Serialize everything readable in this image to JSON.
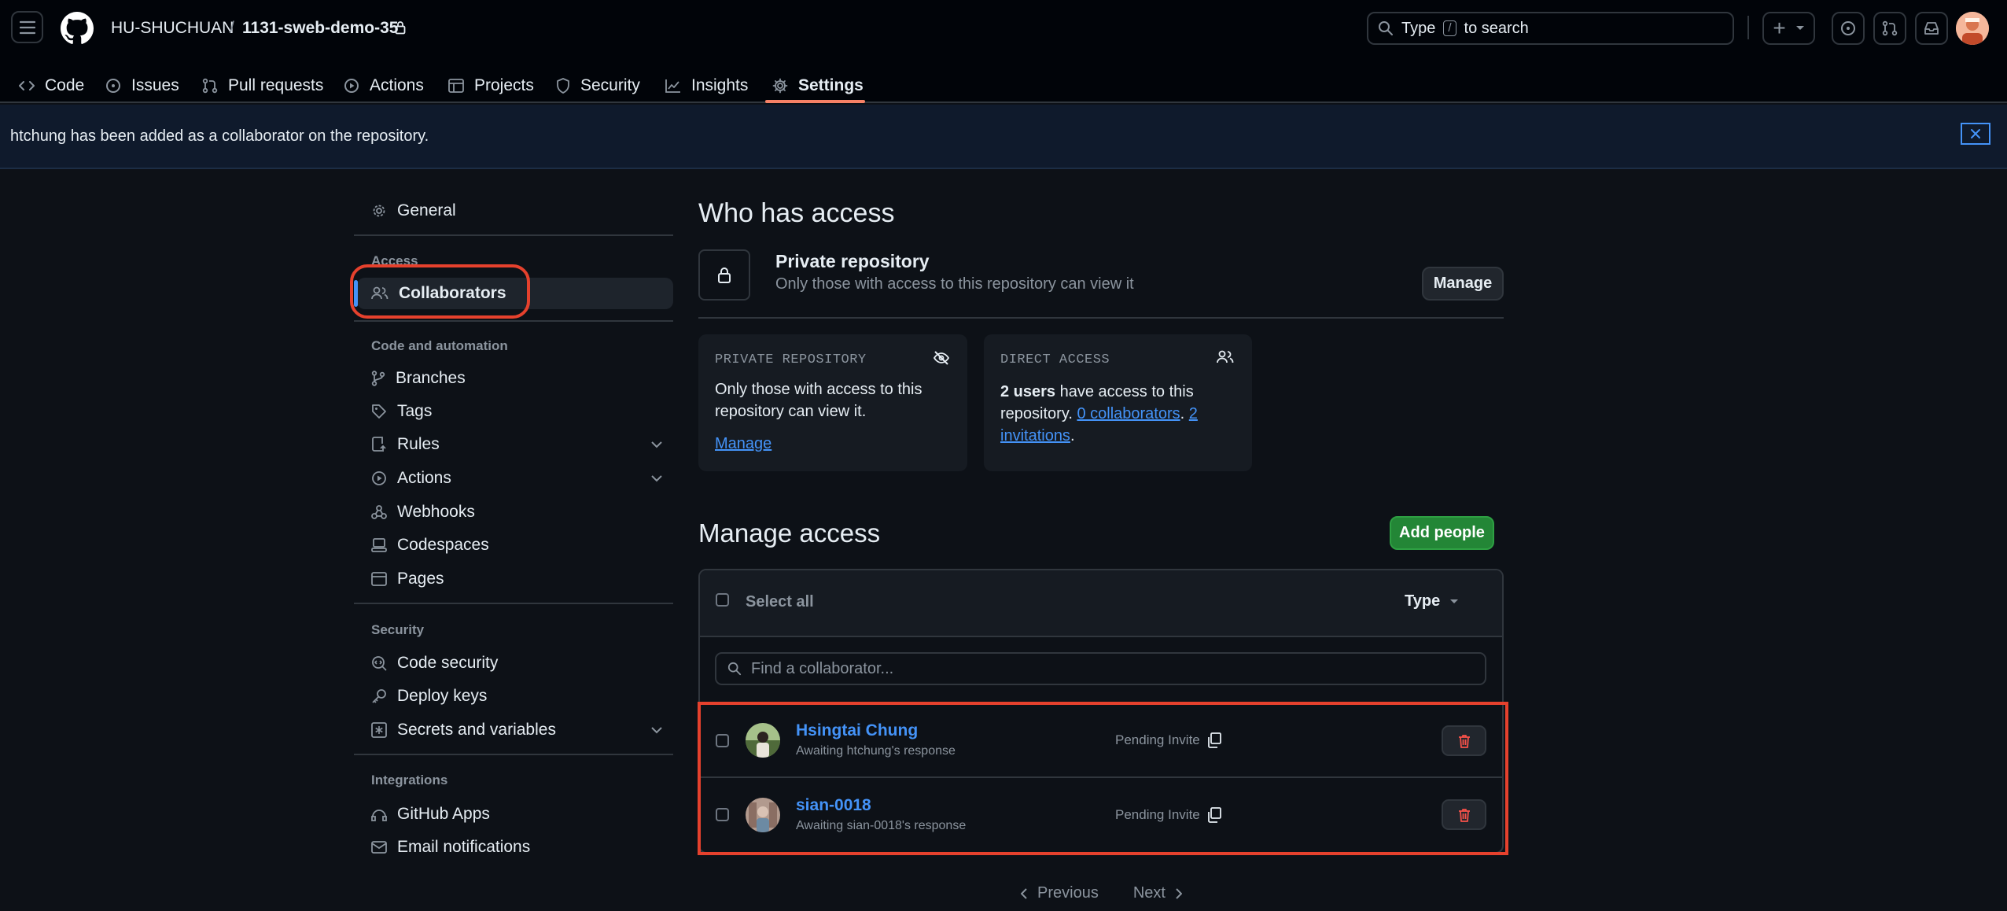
{
  "header": {
    "owner": "HU-SHUCHUAN",
    "separator": "/",
    "repo": "1131-sweb-demo-35",
    "search_placeholder_prefix": "Type",
    "search_key": "/",
    "search_placeholder_suffix": "to search",
    "plus": "+"
  },
  "tabs": [
    {
      "label": "Code",
      "icon": "code-icon"
    },
    {
      "label": "Issues",
      "icon": "issue-icon"
    },
    {
      "label": "Pull requests",
      "icon": "pull-request-icon"
    },
    {
      "label": "Actions",
      "icon": "play-icon"
    },
    {
      "label": "Projects",
      "icon": "table-icon"
    },
    {
      "label": "Security",
      "icon": "shield-icon"
    },
    {
      "label": "Insights",
      "icon": "graph-icon"
    },
    {
      "label": "Settings",
      "icon": "gear-icon",
      "selected": true
    }
  ],
  "flash": {
    "message": "htchung has been added as a collaborator on the repository."
  },
  "sidebar": {
    "general": "General",
    "access_heading": "Access",
    "collaborators": "Collaborators",
    "code_heading": "Code and automation",
    "branches": "Branches",
    "tags": "Tags",
    "rules": "Rules",
    "actions": "Actions",
    "webhooks": "Webhooks",
    "codespaces": "Codespaces",
    "pages": "Pages",
    "security_heading": "Security",
    "code_security": "Code security",
    "deploy_keys": "Deploy keys",
    "secrets": "Secrets and variables",
    "integrations_heading": "Integrations",
    "github_apps": "GitHub Apps",
    "email_notifications": "Email notifications"
  },
  "who": {
    "title": "Who has access",
    "repo_title": "Private repository",
    "repo_desc": "Only those with access to this repository can view it",
    "manage": "Manage"
  },
  "private_card": {
    "label": "PRIVATE REPOSITORY",
    "line1": "Only those with access to this",
    "line2": "repository can view it.",
    "manage": "Manage"
  },
  "direct_card": {
    "label": "DIRECT ACCESS",
    "users": "2 users",
    "t1": "have access to this",
    "t2": "repository.",
    "collaborators": "0 collaborators",
    "dot1": ".",
    "inv1": "2",
    "inv2": "invitations",
    "dot2": "."
  },
  "manage_access": {
    "title": "Manage access",
    "add_people": "Add people",
    "select_all": "Select all",
    "type": "Type",
    "find_placeholder": "Find a collaborator..."
  },
  "collaborators": [
    {
      "name": "Hsingtai Chung",
      "status": "Awaiting htchung's response",
      "state": "Pending Invite"
    },
    {
      "name": "sian-0018",
      "status": "Awaiting sian-0018's response",
      "state": "Pending Invite"
    }
  ],
  "pagination": {
    "previous": "Previous",
    "next": "Next"
  },
  "colors": {
    "accent": "#4493f8",
    "annotation": "#e5412d",
    "primary_button": "#238636",
    "danger": "#f85149"
  }
}
